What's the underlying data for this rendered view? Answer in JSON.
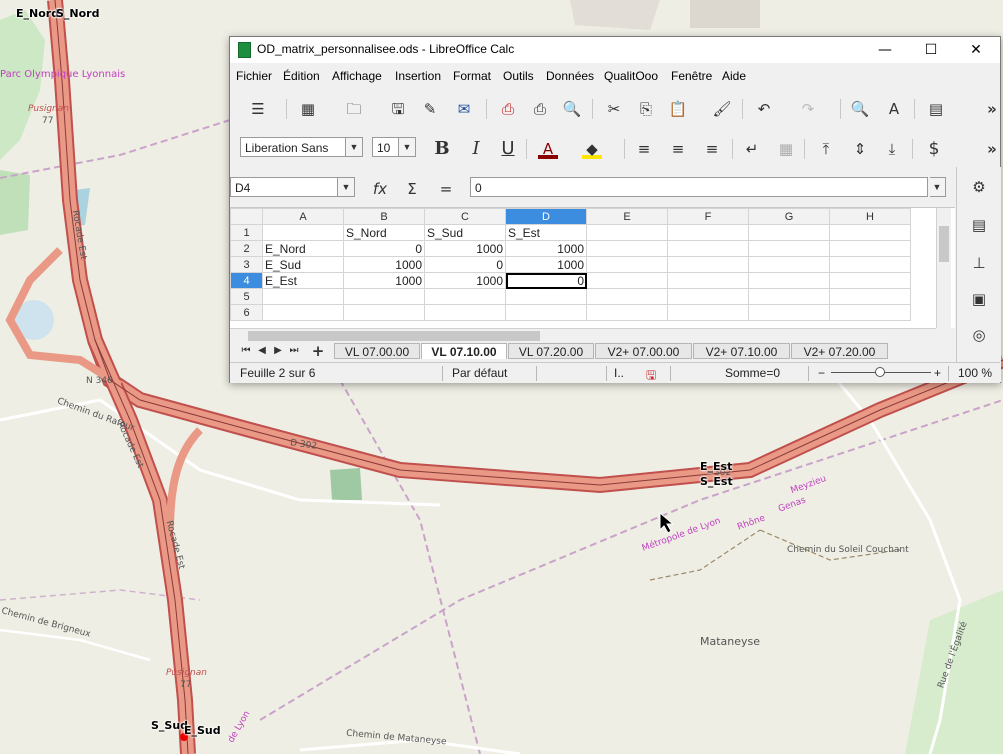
{
  "map": {
    "labels": {
      "parc": "Parc Olympique Lyonnais",
      "pusignan1": "Pusignan",
      "pusignan1_sub": "77",
      "rocade1": "Rocade Est",
      "n346": "N 346",
      "d302": "D 302",
      "d302b": "302",
      "rafour": "Chemin du Rafour",
      "rocade2": "Rocade Est",
      "rocade3": "Rocade Est",
      "brigneux": "Chemin de Brigneux",
      "pusignan2": "Pusignan",
      "pusignan2_sub": "77",
      "metropole": "Métropole de Lyon",
      "rhone": "Rhône",
      "genas": "Genas",
      "meyzieu": "Meyzieu",
      "soleil": "Chemin du Soleil Couchant",
      "mataneyse": "Mataneyse",
      "egalite": "Rue de l'Égalité",
      "chemin_mat": "Chemin de Mataneyse",
      "lyon2": "de Lyon"
    },
    "nodes": {
      "nord_e": "E_Nord",
      "nord_s": "S_Nord",
      "est_e": "E_Est",
      "est_s": "S_Est",
      "sud_s": "S_Sud",
      "sud_e": "E_Sud"
    }
  },
  "window": {
    "title": "OD_matrix_personnalisee.ods - LibreOffice Calc",
    "minimize": "—",
    "maximize": "☐",
    "close": "✕"
  },
  "menu": [
    "Fichier",
    "Édition",
    "Affichage",
    "Insertion",
    "Format",
    "Outils",
    "Données",
    "QualitOoo",
    "Fenêtre",
    "Aide"
  ],
  "toolbar": {
    "font_name": "Liberation Sans",
    "font_size": "10",
    "bold": "B",
    "italic": "I",
    "underline": "U",
    "currency": "$",
    "more": "»"
  },
  "formula": {
    "name_box": "D4",
    "fx": "fx",
    "sum": "Σ",
    "equals": "=",
    "content": "0"
  },
  "sheet": {
    "columns": [
      "A",
      "B",
      "C",
      "D",
      "E",
      "F",
      "G",
      "H"
    ],
    "rows": [
      {
        "n": "1",
        "cells": [
          "",
          "S_Nord",
          "S_Sud",
          "S_Est",
          "",
          "",
          "",
          ""
        ]
      },
      {
        "n": "2",
        "cells": [
          "E_Nord",
          "0",
          "1000",
          "1000",
          "",
          "",
          "",
          ""
        ]
      },
      {
        "n": "3",
        "cells": [
          "E_Sud",
          "1000",
          "0",
          "1000",
          "",
          "",
          "",
          ""
        ]
      },
      {
        "n": "4",
        "cells": [
          "E_Est",
          "1000",
          "1000",
          "0",
          "",
          "",
          "",
          ""
        ]
      },
      {
        "n": "5",
        "cells": [
          "",
          "",
          "",
          "",
          "",
          "",
          "",
          ""
        ]
      },
      {
        "n": "6",
        "cells": [
          "",
          "",
          "",
          "",
          "",
          "",
          "",
          ""
        ]
      }
    ]
  },
  "tabs": [
    "VL 07.00.00",
    "VL 07.10.00",
    "VL 07.20.00",
    "V2+ 07.00.00",
    "V2+ 07.10.00",
    "V2+ 07.20.00"
  ],
  "active_tab_index": 1,
  "status": {
    "sheet": "Feuille 2 sur 6",
    "style": "Par défaut",
    "sum": "Somme=0",
    "zoom": "100 %",
    "zoom_minus": "−",
    "zoom_plus": "+"
  }
}
